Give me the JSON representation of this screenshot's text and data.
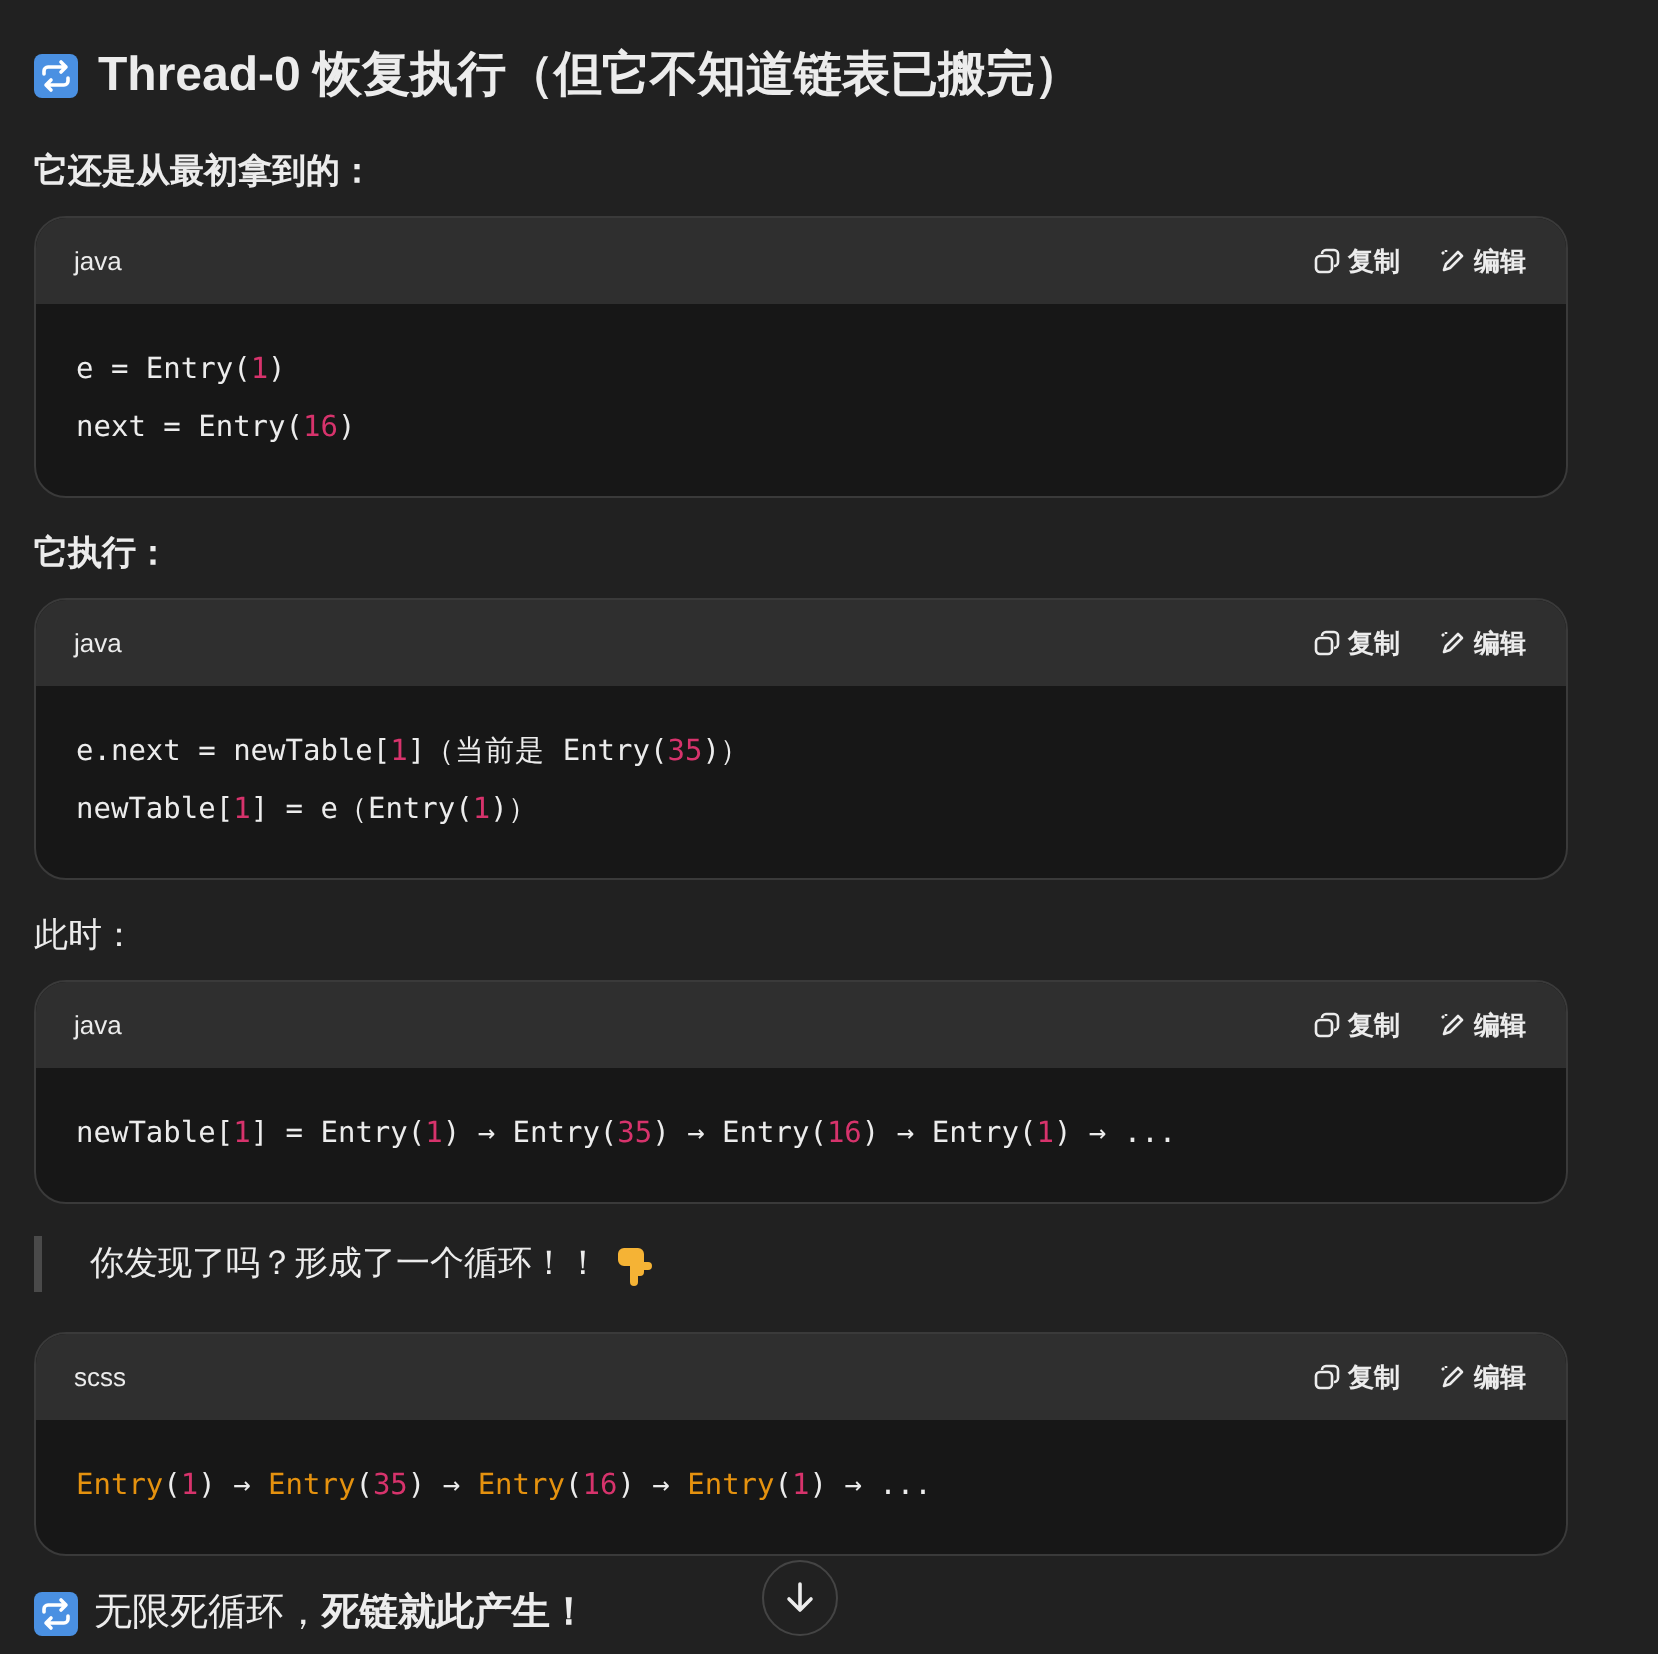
{
  "blocks": [
    {
      "kind": "heading",
      "text": "Thread-0 恢复执行（但它不知道链表已搬完）"
    },
    {
      "kind": "label",
      "bold": true,
      "text": "它还是从最初拿到的："
    },
    {
      "kind": "code",
      "language": "java",
      "copy": "复制",
      "edit": "编辑",
      "lines": [
        [
          {
            "kind": "plain",
            "text": "e = Entry("
          },
          {
            "kind": "number",
            "text": "1"
          },
          {
            "kind": "plain",
            "text": ")"
          }
        ],
        [
          {
            "kind": "plain",
            "text": "next = Entry("
          },
          {
            "kind": "number",
            "text": "16"
          },
          {
            "kind": "plain",
            "text": ")"
          }
        ]
      ]
    },
    {
      "kind": "label",
      "bold": true,
      "text": "它执行："
    },
    {
      "kind": "code",
      "language": "java",
      "copy": "复制",
      "edit": "编辑",
      "lines": [
        [
          {
            "kind": "plain",
            "text": "e.next = newTable["
          },
          {
            "kind": "number",
            "text": "1"
          },
          {
            "kind": "plain",
            "text": "]（当前是 Entry("
          },
          {
            "kind": "number",
            "text": "35"
          },
          {
            "kind": "plain",
            "text": ")）"
          }
        ],
        [
          {
            "kind": "plain",
            "text": "newTable["
          },
          {
            "kind": "number",
            "text": "1"
          },
          {
            "kind": "plain",
            "text": "] = e（Entry("
          },
          {
            "kind": "number",
            "text": "1"
          },
          {
            "kind": "plain",
            "text": ")）"
          }
        ]
      ]
    },
    {
      "kind": "label",
      "bold": false,
      "text": "此时："
    },
    {
      "kind": "code",
      "language": "java",
      "copy": "复制",
      "edit": "编辑",
      "lines": [
        [
          {
            "kind": "plain",
            "text": "newTable["
          },
          {
            "kind": "number",
            "text": "1"
          },
          {
            "kind": "plain",
            "text": "] = Entry("
          },
          {
            "kind": "number",
            "text": "1"
          },
          {
            "kind": "plain",
            "text": ") → Entry("
          },
          {
            "kind": "number",
            "text": "35"
          },
          {
            "kind": "plain",
            "text": ") → Entry("
          },
          {
            "kind": "number",
            "text": "16"
          },
          {
            "kind": "plain",
            "text": ") → Entry("
          },
          {
            "kind": "number",
            "text": "1"
          },
          {
            "kind": "plain",
            "text": ") → ..."
          }
        ]
      ]
    },
    {
      "kind": "quote",
      "text": "你发现了吗？形成了一个循环！！"
    },
    {
      "kind": "code",
      "language": "scss",
      "copy": "复制",
      "edit": "编辑",
      "lines": [
        [
          {
            "kind": "func",
            "text": "Entry"
          },
          {
            "kind": "plain",
            "text": "("
          },
          {
            "kind": "number",
            "text": "1"
          },
          {
            "kind": "plain",
            "text": ") → "
          },
          {
            "kind": "func",
            "text": "Entry"
          },
          {
            "kind": "plain",
            "text": "("
          },
          {
            "kind": "number",
            "text": "35"
          },
          {
            "kind": "plain",
            "text": ") → "
          },
          {
            "kind": "func",
            "text": "Entry"
          },
          {
            "kind": "plain",
            "text": "("
          },
          {
            "kind": "number",
            "text": "16"
          },
          {
            "kind": "plain",
            "text": ") → "
          },
          {
            "kind": "func",
            "text": "Entry"
          },
          {
            "kind": "plain",
            "text": "("
          },
          {
            "kind": "number",
            "text": "1"
          },
          {
            "kind": "plain",
            "text": ") → ..."
          }
        ]
      ]
    },
    {
      "kind": "footer",
      "text": "无限死循环，**死链就此产生！**"
    }
  ]
}
